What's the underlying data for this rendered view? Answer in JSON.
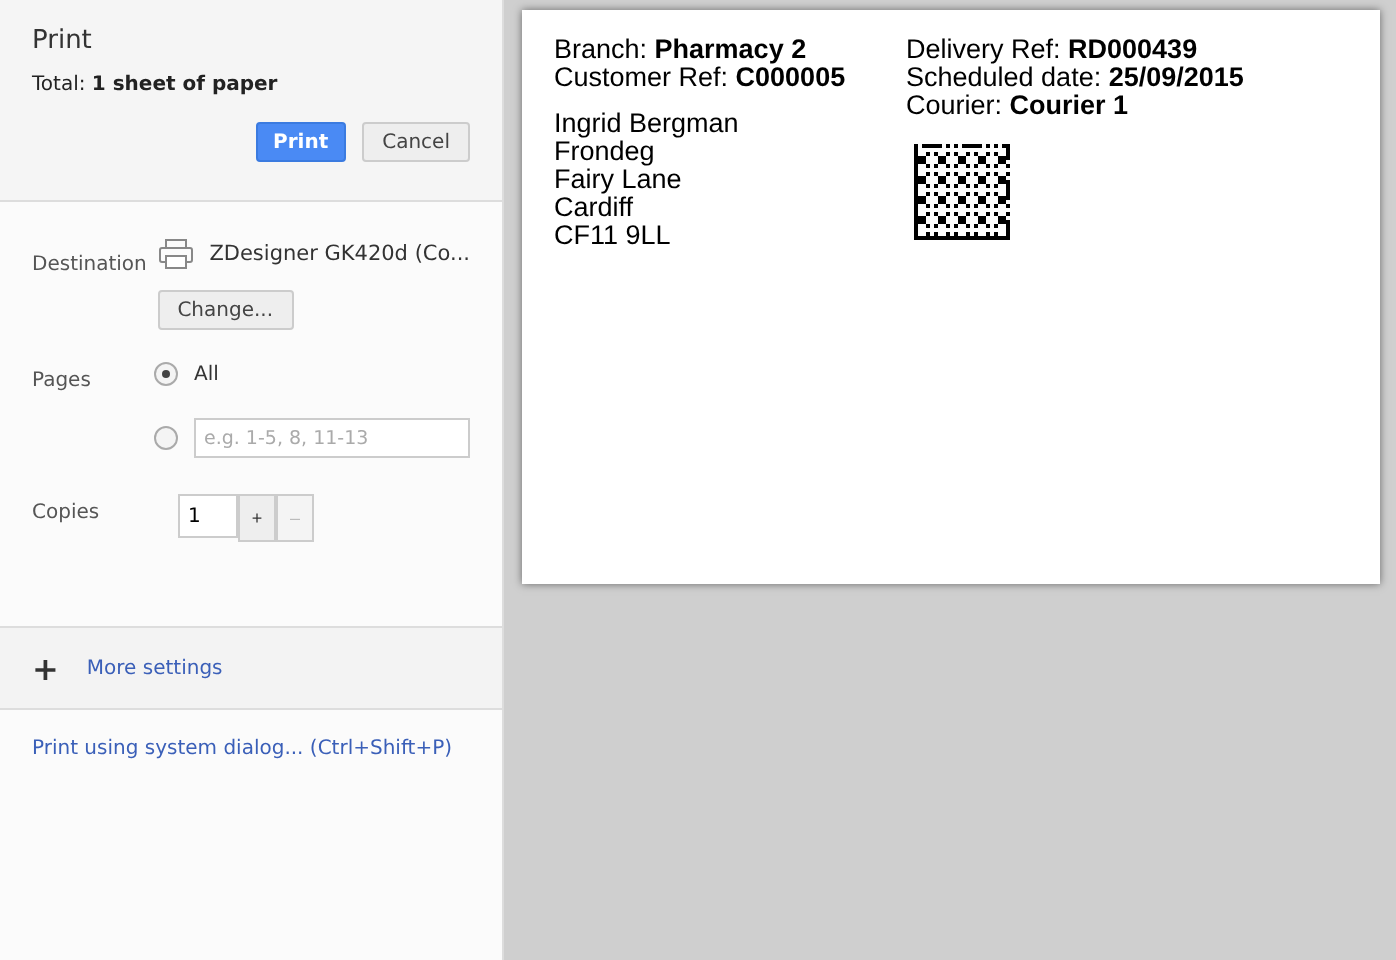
{
  "header": {
    "title": "Print",
    "total": "Total: **1 sheet of paper**",
    "buttons": [
      {
        "label": "Print",
        "kind": "primary"
      },
      {
        "label": "Cancel",
        "kind": "secondary"
      }
    ]
  },
  "destination": {
    "label": "Destination",
    "printer": "ZDesigner GK420d (Co...",
    "button": "Change..."
  },
  "pages": {
    "label": "Pages",
    "options": [
      {
        "kind": "label",
        "text": "All",
        "selected": true
      },
      {
        "kind": "field",
        "placeholder": "e.g. 1-5, 8, 11-13",
        "selected": false
      }
    ]
  },
  "copies": {
    "label": "Copies",
    "value": "1",
    "buttons": [
      {
        "label": "+",
        "disabled": false
      },
      {
        "label": "–",
        "disabled": true
      }
    ]
  },
  "more_settings": {
    "icon": "+",
    "label": "More settings"
  },
  "system_dialog_link": "Print using system dialog... (Ctrl+Shift+P)",
  "preview": {
    "left": [
      "Branch: **Pharmacy 2**",
      "Customer Ref: **C000005**"
    ],
    "right": [
      "Delivery Ref: **RD000439**",
      "Scheduled date: **25/09/2015**",
      "Courier: **Courier 1**"
    ],
    "address": [
      "Ingrid Bergman",
      "Frondeg",
      "Fairy Lane",
      "Cardiff",
      "CF11 9LL"
    ]
  }
}
